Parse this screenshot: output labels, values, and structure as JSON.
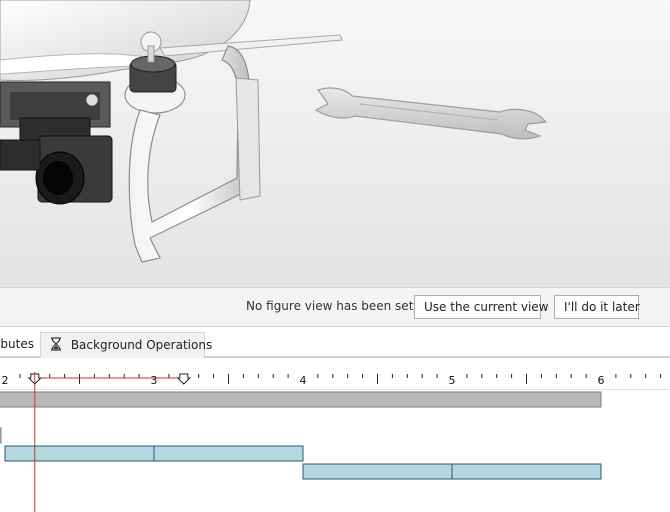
{
  "notification": {
    "message": "No figure view has been set",
    "use_view_label": "Use the current view",
    "later_label": "I'll do it later"
  },
  "tabs": {
    "attributes_label": "ibutes",
    "background_ops_label": "Background Operations"
  },
  "timeline": {
    "ticks": [
      "2",
      "3",
      "4",
      "5",
      "6"
    ],
    "playhead_time": 2.2,
    "range_start": 2.2,
    "range_end": 3.2,
    "bars": [
      {
        "row": 0,
        "start": 1.9,
        "end": 6.0,
        "color": "#b9b9b9"
      },
      {
        "row": 1,
        "start": 1.9,
        "end": 1.95,
        "color": "#b9b9b9"
      },
      {
        "row": 2,
        "start": 2.0,
        "end": 3.0,
        "color": "#b7d7e0"
      },
      {
        "row": 2,
        "start": 3.0,
        "end": 4.0,
        "color": "#b7d7e0"
      },
      {
        "row": 3,
        "start": 4.0,
        "end": 5.0,
        "color": "#b7d7e0"
      },
      {
        "row": 3,
        "start": 5.0,
        "end": 6.0,
        "color": "#b7d7e0"
      }
    ]
  }
}
